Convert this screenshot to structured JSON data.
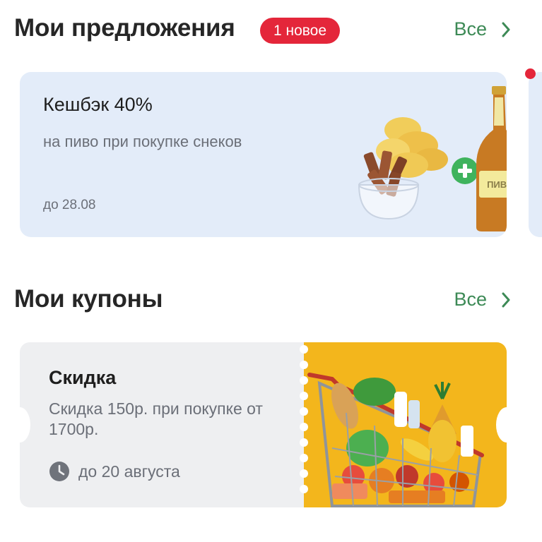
{
  "offers_section": {
    "title": "Мои предложения",
    "badge": "1 новое",
    "see_all": "Все"
  },
  "offer_card": {
    "title": "Кешбэк 40%",
    "subtitle": "на пиво при покупке снеков",
    "valid_until": "до 28.08",
    "bottle_label": "ПИВО",
    "background": "#e3ecf9"
  },
  "coupons_section": {
    "title": "Мои купоны",
    "see_all": "Все"
  },
  "coupon_card": {
    "title": "Скидка",
    "description": "Скидка 150р. при покупке от 1700р.",
    "valid_until": "до 20 августа",
    "image_background": "#f3b61c"
  },
  "icons": {
    "see_all_arrow": "chevron-right-icon",
    "coupon_clock": "clock-icon",
    "offer_plus": "plus-icon"
  },
  "colors": {
    "accent_green": "#3d8a56",
    "badge_red": "#e4263a",
    "unread_dot": "#e4263a"
  }
}
